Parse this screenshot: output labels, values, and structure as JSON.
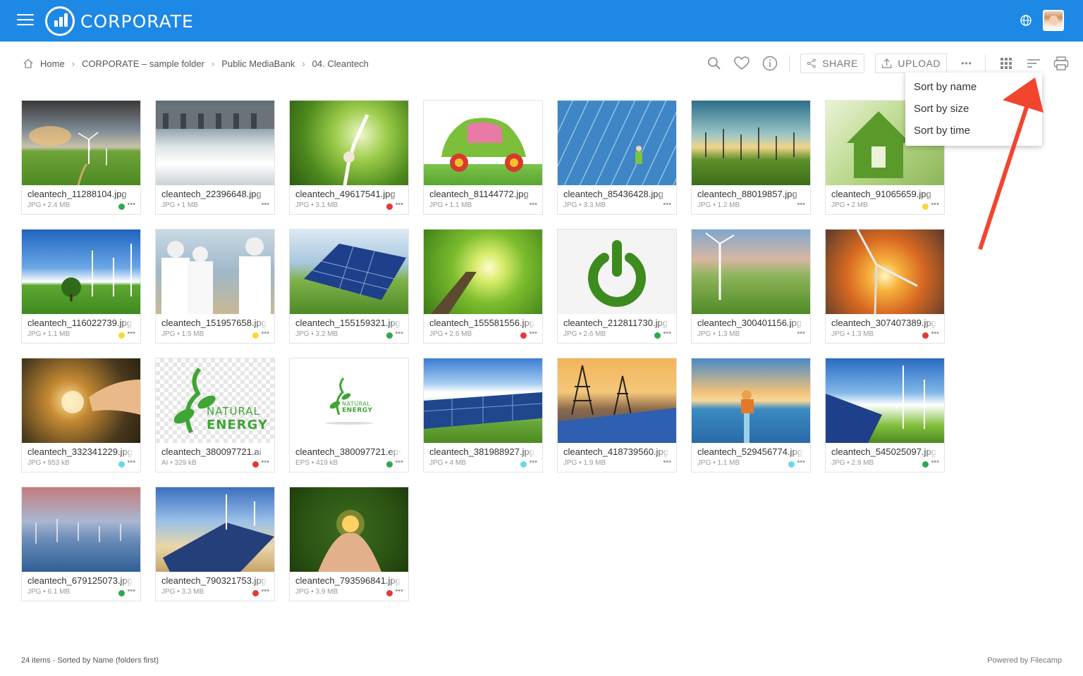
{
  "app": {
    "brand": "CORPORATE"
  },
  "breadcrumb": [
    "Home",
    "CORPORATE – sample folder",
    "Public MediaBank",
    "04. Cleantech"
  ],
  "toolbar": {
    "share_label": "SHARE",
    "upload_label": "UPLOAD",
    "more_label": "•••"
  },
  "sort_menu": [
    "Sort by name",
    "Sort by size",
    "Sort by time"
  ],
  "colors": {
    "header": "#1e88e5",
    "green": "#2fa84f",
    "red": "#e53935",
    "yellow": "#fdd835",
    "cyan": "#6dd5ed",
    "arrow": "#f2452e"
  },
  "files": [
    {
      "name": "cleantech_11288104.jpg",
      "meta": "JPG • 2.4 MB",
      "label": "green"
    },
    {
      "name": "cleantech_22396648.jpg",
      "meta": "JPG • 1 MB",
      "label": "none"
    },
    {
      "name": "cleantech_49617541.jpg",
      "meta": "JPG • 3.1 MB",
      "label": "red"
    },
    {
      "name": "cleantech_81144772.jpg",
      "meta": "JPG • 1.1 MB",
      "label": "none"
    },
    {
      "name": "cleantech_85436428.jpg",
      "meta": "JPG • 3.3 MB",
      "label": "none"
    },
    {
      "name": "cleantech_88019857.jpg",
      "meta": "JPG • 1.2 MB",
      "label": "none"
    },
    {
      "name": "cleantech_91065659.jpg",
      "meta": "JPG • 2 MB",
      "label": "yellow"
    },
    {
      "name": "cleantech_116022739.jpg",
      "meta": "JPG • 1.1 MB",
      "label": "yellow"
    },
    {
      "name": "cleantech_151957658.jpg",
      "meta": "JPG • 1.5 MB",
      "label": "yellow"
    },
    {
      "name": "cleantech_155159321.jpg",
      "meta": "JPG • 3.2 MB",
      "label": "green"
    },
    {
      "name": "cleantech_155581556.jpg",
      "meta": "JPG • 2.6 MB",
      "label": "red"
    },
    {
      "name": "cleantech_212811730.jpg",
      "meta": "JPG • 2.6 MB",
      "label": "green"
    },
    {
      "name": "cleantech_300401156.jpg",
      "meta": "JPG • 1.3 MB",
      "label": "none"
    },
    {
      "name": "cleantech_307407389.jpg",
      "meta": "JPG • 1.3 MB",
      "label": "red"
    },
    {
      "name": "cleantech_332341229.jpg",
      "meta": "JPG • 953 kB",
      "label": "cyan"
    },
    {
      "name": "cleantech_380097721.ai",
      "meta": "AI • 329 kB",
      "label": "red"
    },
    {
      "name": "cleantech_380097721.eps",
      "meta": "EPS • 419 kB",
      "label": "green"
    },
    {
      "name": "cleantech_381988927.jpg",
      "meta": "JPG • 4 MB",
      "label": "cyan"
    },
    {
      "name": "cleantech_418739560.jpg",
      "meta": "JPG • 1.9 MB",
      "label": "none"
    },
    {
      "name": "cleantech_529456774.jpg",
      "meta": "JPG • 1.1 MB",
      "label": "cyan"
    },
    {
      "name": "cleantech_545025097.jpg",
      "meta": "JPG • 2.9 MB",
      "label": "green"
    },
    {
      "name": "cleantech_679125073.jpg",
      "meta": "JPG • 6.1 MB",
      "label": "green"
    },
    {
      "name": "cleantech_790321753.jpg",
      "meta": "JPG • 3.3 MB",
      "label": "red"
    },
    {
      "name": "cleantech_793596841.jpg",
      "meta": "JPG • 3.9 MB",
      "label": "red"
    }
  ],
  "thumb_logo_text": {
    "line1": "NATURAL",
    "line2": "ENERGY"
  },
  "footer": {
    "status": "24 items - Sorted by Name (folders first)",
    "powered": "Powered by Filecamp"
  }
}
